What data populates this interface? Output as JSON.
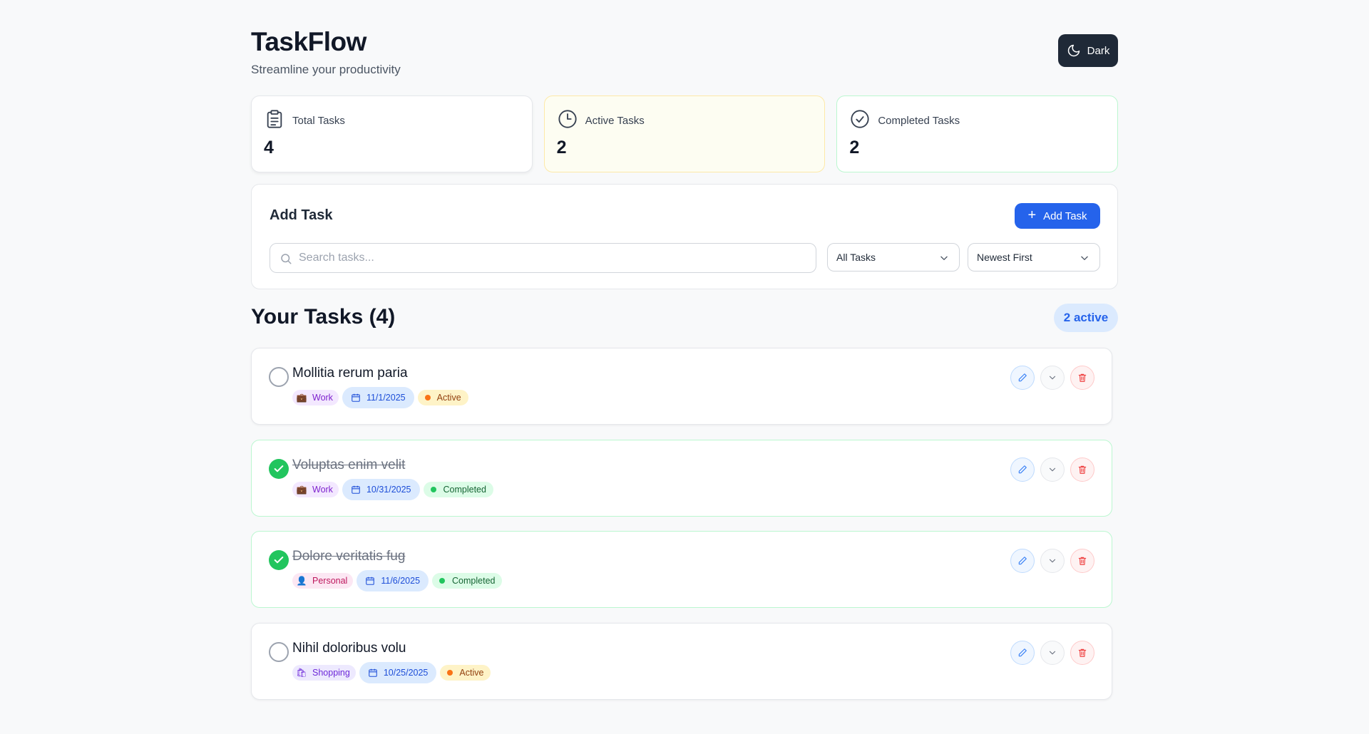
{
  "app": {
    "title": "TaskFlow",
    "subtitle": "Streamline your productivity",
    "theme_button": "Dark"
  },
  "stats": [
    {
      "label": "Total Tasks",
      "value": "4",
      "icon": "clipboard-icon"
    },
    {
      "label": "Active Tasks",
      "value": "2",
      "icon": "clock-icon"
    },
    {
      "label": "Completed Tasks",
      "value": "2",
      "icon": "check-circle-icon"
    }
  ],
  "add_task": {
    "title": "Add Task",
    "button_label": "Add Task",
    "search_placeholder": "Search tasks...",
    "filter_value": "All Tasks",
    "sort_value": "Newest First"
  },
  "tasks_section": {
    "title": "Your Tasks (4)",
    "active_badge": "2 active"
  },
  "tasks": [
    {
      "title": "Mollitia rerum paria",
      "completed": false,
      "category": "Work",
      "category_icon": "briefcase-emoji",
      "date": "11/1/2025",
      "status": "Active"
    },
    {
      "title": "Voluptas enim velit",
      "completed": true,
      "category": "Work",
      "category_icon": "briefcase-emoji",
      "date": "10/31/2025",
      "status": "Completed"
    },
    {
      "title": "Dolore veritatis fug",
      "completed": true,
      "category": "Personal",
      "category_icon": "person-emoji",
      "date": "11/6/2025",
      "status": "Completed"
    },
    {
      "title": "Nihil doloribus volu",
      "completed": false,
      "category": "Shopping",
      "category_icon": "shopping-bags-emoji",
      "date": "10/25/2025",
      "status": "Active"
    }
  ],
  "colors": {
    "primary": "#2563eb",
    "completed_green": "#22c55e",
    "active_orange": "#f97316",
    "dark_button": "#1f2937"
  }
}
